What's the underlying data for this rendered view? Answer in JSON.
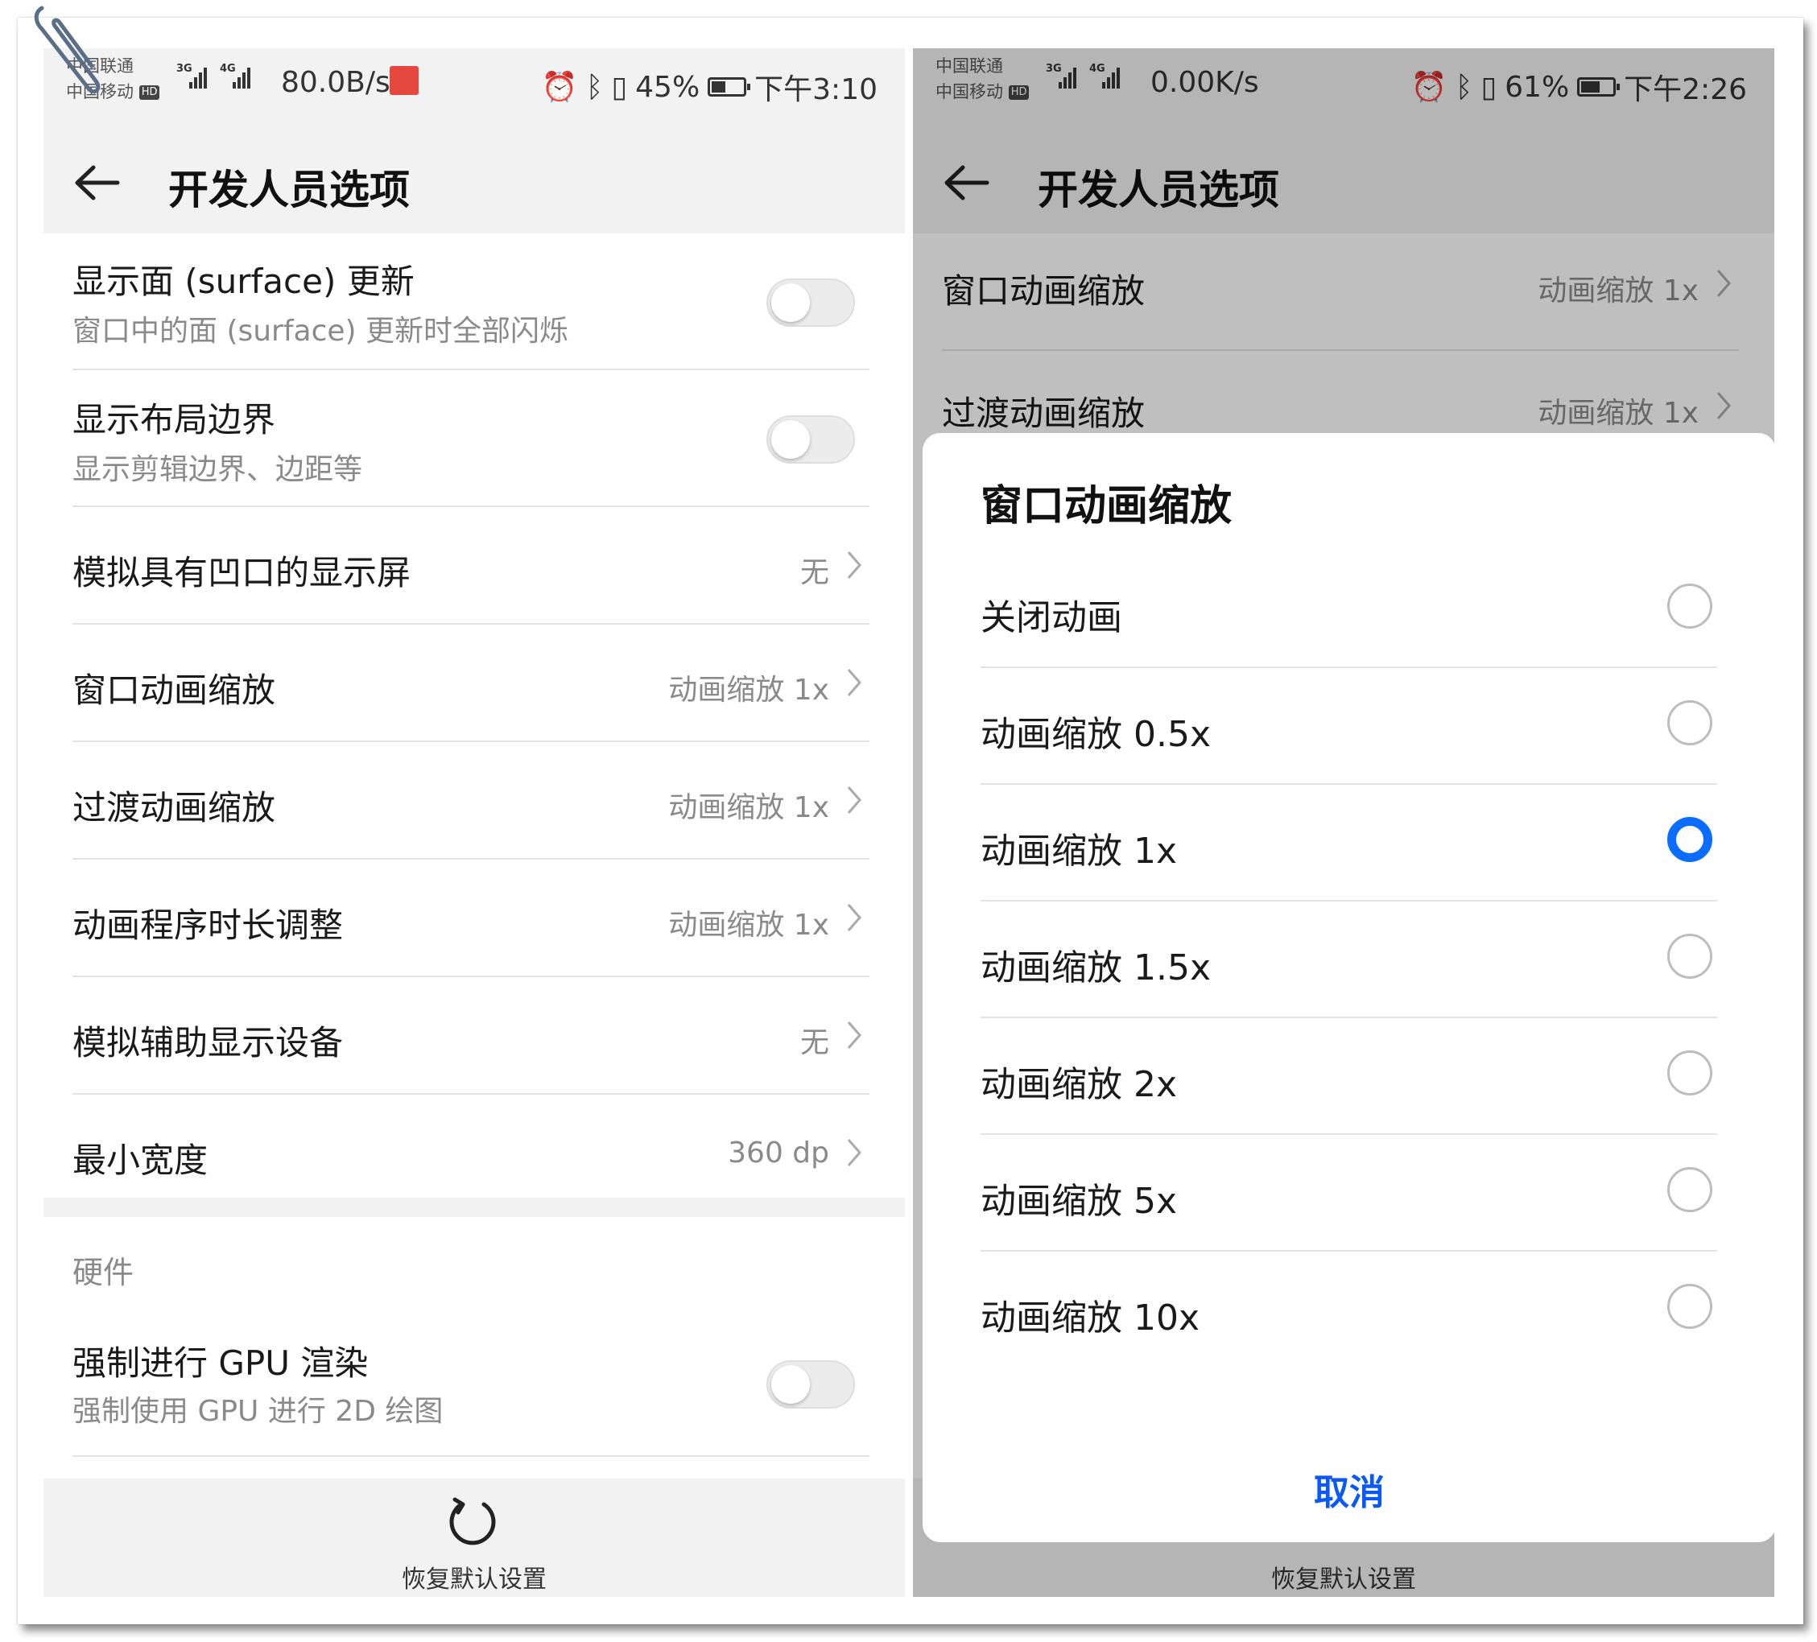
{
  "left": {
    "status": {
      "carrier1": "中国联通",
      "carrier2": "中国移动",
      "hd": "HD",
      "net1": "3G",
      "net2": "4G",
      "speed": "80.0B/s",
      "battery_pct": "45%",
      "battery_level": 0.45,
      "time": "下午3:10"
    },
    "title": "开发人员选项",
    "items": [
      {
        "title": "显示面 (surface) 更新",
        "subtitle": "窗口中的面 (surface) 更新时全部闪烁",
        "toggle": false
      },
      {
        "title": "显示布局边界",
        "subtitle": "显示剪辑边界、边距等",
        "toggle": false
      },
      {
        "title": "模拟具有凹口的显示屏",
        "value": "无"
      },
      {
        "title": "窗口动画缩放",
        "value": "动画缩放 1x"
      },
      {
        "title": "过渡动画缩放",
        "value": "动画缩放 1x"
      },
      {
        "title": "动画程序时长调整",
        "value": "动画缩放 1x"
      },
      {
        "title": "模拟辅助显示设备",
        "value": "无"
      },
      {
        "title": "最小宽度",
        "value": "360 dp"
      }
    ],
    "section": "硬件",
    "hw_item": {
      "title": "强制进行 GPU 渲染",
      "subtitle": "强制使用 GPU 进行 2D 绘图",
      "toggle": false
    },
    "restore": "恢复默认设置"
  },
  "right": {
    "status": {
      "carrier1": "中国联通",
      "carrier2": "中国移动",
      "hd": "HD",
      "net1": "3G",
      "net2": "4G",
      "speed": "0.00K/s",
      "battery_pct": "61%",
      "battery_level": 0.61,
      "time": "下午2:26"
    },
    "title": "开发人员选项",
    "items": [
      {
        "title": "窗口动画缩放",
        "value": "动画缩放 1x"
      },
      {
        "title": "过渡动画缩放",
        "value": "动画缩放 1x"
      }
    ],
    "dialog": {
      "title": "窗口动画缩放",
      "options": [
        "关闭动画",
        "动画缩放 0.5x",
        "动画缩放 1x",
        "动画缩放 1.5x",
        "动画缩放 2x",
        "动画缩放 5x",
        "动画缩放 10x"
      ],
      "selected_index": 2,
      "cancel": "取消"
    },
    "restore": "恢复默认设置"
  },
  "colors": {
    "accent": "#0a6dff",
    "cancel": "#0a59f7",
    "bar_bg": "#f2f2f2",
    "secondary_text": "#8a8a8a"
  },
  "icons": [
    "paperclip-icon",
    "back-arrow-icon",
    "chevron-right-icon",
    "restore-icon",
    "alarm-icon",
    "bluetooth-icon",
    "vibrate-icon",
    "battery-icon"
  ]
}
